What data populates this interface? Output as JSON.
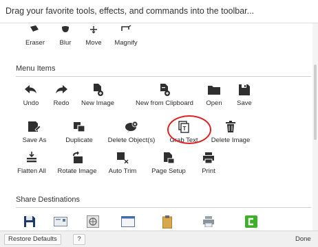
{
  "header": {
    "text": "Drag your favorite tools, effects, and commands into the toolbar..."
  },
  "tools_top": [
    {
      "label": "Eraser",
      "icon": "eraser-icon"
    },
    {
      "label": "Blur",
      "icon": "blur-icon"
    },
    {
      "label": "Move",
      "icon": "move-icon"
    },
    {
      "label": "Magnify",
      "icon": "magnify-icon"
    }
  ],
  "menu_items": {
    "title": "Menu Items",
    "row1": [
      {
        "label": "Undo",
        "icon": "undo-icon"
      },
      {
        "label": "Redo",
        "icon": "redo-icon"
      },
      {
        "label": "New Image",
        "icon": "new-image-icon"
      },
      {
        "label": "New from Clipboard",
        "icon": "new-from-clipboard-icon"
      },
      {
        "label": "Open",
        "icon": "folder-icon"
      },
      {
        "label": "Save",
        "icon": "save-icon"
      }
    ],
    "row2": [
      {
        "label": "Save As",
        "icon": "save-as-icon"
      },
      {
        "label": "Duplicate",
        "icon": "duplicate-icon"
      },
      {
        "label": "Delete Object(s)",
        "icon": "delete-object-icon"
      },
      {
        "label": "Grab Text",
        "icon": "grab-text-icon"
      },
      {
        "label": "Delete Image",
        "icon": "trash-icon"
      }
    ],
    "row3": [
      {
        "label": "Flatten All",
        "icon": "flatten-icon"
      },
      {
        "label": "Rotate Image",
        "icon": "rotate-image-icon"
      },
      {
        "label": "Auto Trim",
        "icon": "auto-trim-icon"
      },
      {
        "label": "Page Setup",
        "icon": "page-setup-icon"
      },
      {
        "label": "Print",
        "icon": "print-icon"
      }
    ]
  },
  "share_destinations": {
    "title": "Share Destinations",
    "icons": [
      "save-destination-icon",
      "email-icon",
      "web-icon",
      "window-icon",
      "clipboard-icon",
      "printer-icon",
      "camtasia-icon"
    ]
  },
  "footer": {
    "restore": "Restore Defaults",
    "help": "?",
    "done": "Done"
  },
  "colors": {
    "icon": "#2f2f2f",
    "highlight": "#e02020",
    "camtasia": "#3fae2a",
    "clipboard": "#d9a84a"
  }
}
